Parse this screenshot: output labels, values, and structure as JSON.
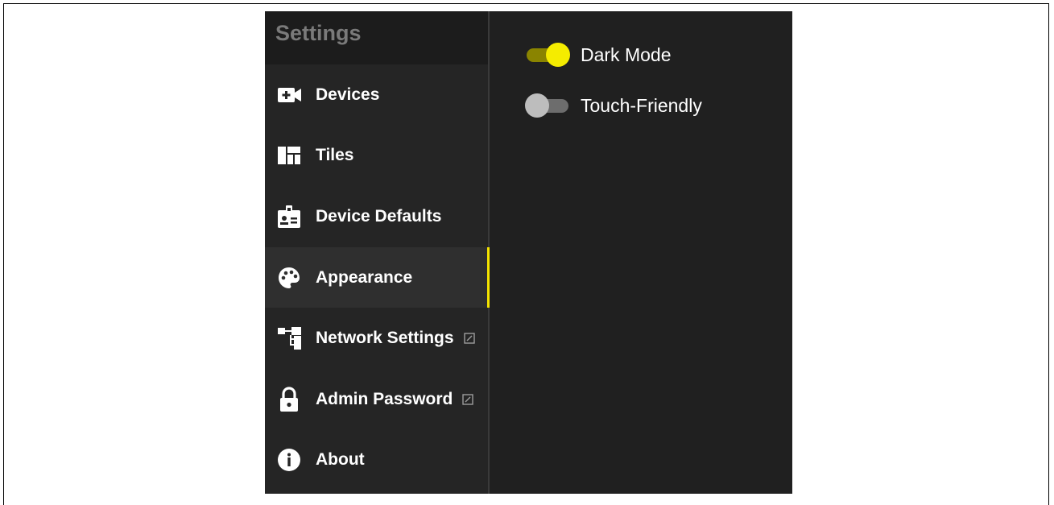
{
  "sidebar": {
    "title": "Settings",
    "items": [
      {
        "label": "Devices",
        "icon": "add-video-icon",
        "active": false,
        "external": false
      },
      {
        "label": "Tiles",
        "icon": "tiles-icon",
        "active": false,
        "external": false
      },
      {
        "label": "Device Defaults",
        "icon": "badge-icon",
        "active": false,
        "external": false
      },
      {
        "label": "Appearance",
        "icon": "palette-icon",
        "active": true,
        "external": false
      },
      {
        "label": "Network Settings",
        "icon": "network-icon",
        "active": false,
        "external": true
      },
      {
        "label": "Admin Password",
        "icon": "lock-icon",
        "active": false,
        "external": true
      },
      {
        "label": "About",
        "icon": "info-icon",
        "active": false,
        "external": false
      }
    ]
  },
  "appearance": {
    "toggles": [
      {
        "label": "Dark Mode",
        "checked": true
      },
      {
        "label": "Touch-Friendly",
        "checked": false
      }
    ]
  },
  "colors": {
    "accent": "#f5e400",
    "background": "#202020",
    "sidebar": "#252525"
  }
}
